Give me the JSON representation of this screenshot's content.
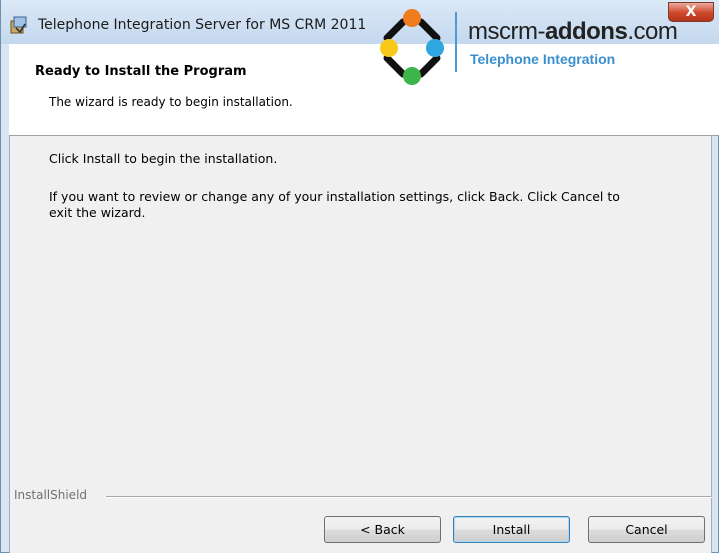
{
  "window": {
    "title": "Telephone Integration Server for MS CRM 2011",
    "close_glyph": "X"
  },
  "banner": {
    "title": "Ready to Install the Program",
    "subtitle": "The wizard is ready to begin installation.",
    "logo": {
      "name_regular": "mscrm-",
      "name_bold": "addons",
      "name_tail": ".com",
      "tagline": "Telephone Integration"
    }
  },
  "content": {
    "line1": "Click Install to begin the installation.",
    "line2a": "If you want to review or change any of your installation settings, click Back. Click Cancel to",
    "line2b": "exit the wizard."
  },
  "footer": {
    "brand": "InstallShield",
    "back_label": "< Back",
    "install_label": "Install",
    "cancel_label": "Cancel"
  },
  "colors": {
    "close_red": "#d0472b",
    "logo_blue": "#3a8fcf",
    "banner_bg": "#ffffff",
    "client_bg": "#f0f0f0"
  }
}
